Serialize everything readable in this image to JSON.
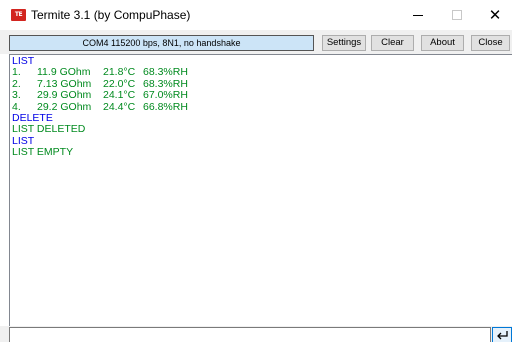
{
  "window": {
    "title": "Termite 3.1 (by CompuPhase)",
    "icon": "termite-app-icon",
    "controls": {
      "minimize": "minimize-icon",
      "maximize": "maximize-icon",
      "close": "close-icon",
      "close_glyph": "✕"
    }
  },
  "toolbar": {
    "status": "COM4 115200 bps, 8N1, no handshake",
    "settings_label": "Settings",
    "clear_label": "Clear",
    "about_label": "About",
    "close_label": "Close"
  },
  "terminal": {
    "colors": {
      "sent": "#0000e6",
      "received": "#008a1e"
    },
    "lines": [
      {
        "dir": "sent",
        "text": "LIST"
      },
      {
        "dir": "received",
        "cols": [
          "1.",
          "11.9 GOhm",
          "21.8°C",
          "68.3%RH"
        ]
      },
      {
        "dir": "received",
        "cols": [
          "2.",
          "7.13 GOhm",
          "22.0°C",
          "68.3%RH"
        ]
      },
      {
        "dir": "received",
        "cols": [
          "3.",
          "29.9 GOhm",
          "24.1°C",
          "67.0%RH"
        ]
      },
      {
        "dir": "received",
        "cols": [
          "4.",
          "29.2 GOhm",
          "24.4°C",
          "66.8%RH"
        ]
      },
      {
        "dir": "sent",
        "text": "DELETE"
      },
      {
        "dir": "received",
        "text": "LIST DELETED"
      },
      {
        "dir": "sent",
        "text": "LIST"
      },
      {
        "dir": "received",
        "text": "LIST EMPTY"
      }
    ]
  },
  "input": {
    "value": "",
    "placeholder": "",
    "enter_icon": "enter-icon"
  }
}
